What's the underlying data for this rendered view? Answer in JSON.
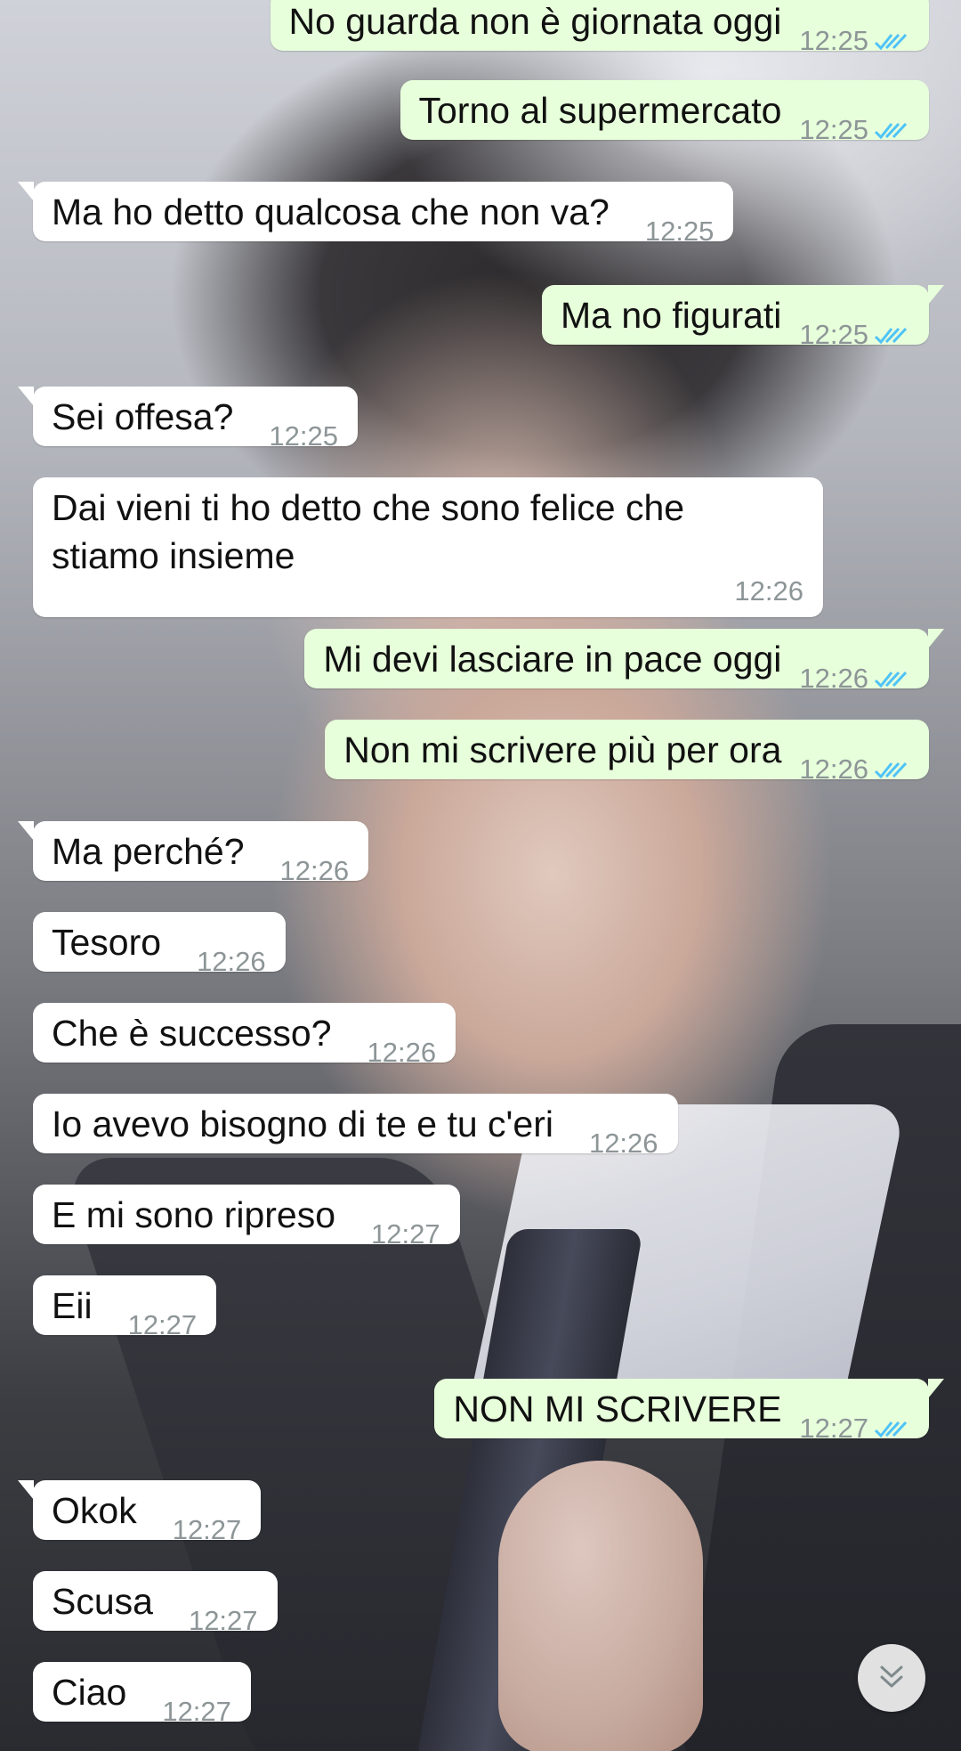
{
  "colors": {
    "incoming_bubble": "#ffffff",
    "outgoing_bubble": "#e7ffdb",
    "timestamp": "#8d9597",
    "read_ticks": "#4fc3f7"
  },
  "messages": [
    {
      "dir": "out",
      "text": "No guarda non è giornata oggi",
      "time": "12:25",
      "status": "read"
    },
    {
      "dir": "out",
      "text": "Torno al supermercato",
      "time": "12:25",
      "status": "read"
    },
    {
      "dir": "in",
      "text": "Ma ho detto qualcosa che non va?",
      "time": "12:25"
    },
    {
      "dir": "out",
      "text": "Ma no figurati",
      "time": "12:25",
      "status": "read"
    },
    {
      "dir": "in",
      "text": "Sei offesa?",
      "time": "12:25"
    },
    {
      "dir": "in",
      "text_line1": "Dai vieni ti ho detto che sono felice che",
      "text_line2": "stiamo insieme",
      "time": "12:26"
    },
    {
      "dir": "out",
      "text": "Mi devi lasciare in pace oggi",
      "time": "12:26",
      "status": "read"
    },
    {
      "dir": "out",
      "text": "Non mi scrivere più per ora",
      "time": "12:26",
      "status": "read"
    },
    {
      "dir": "in",
      "text": "Ma perché?",
      "time": "12:26"
    },
    {
      "dir": "in",
      "text": "Tesoro",
      "time": "12:26"
    },
    {
      "dir": "in",
      "text": "Che è successo?",
      "time": "12:26"
    },
    {
      "dir": "in",
      "text": "Io avevo bisogno di te e tu c'eri",
      "time": "12:26"
    },
    {
      "dir": "in",
      "text": "E mi sono ripreso",
      "time": "12:27"
    },
    {
      "dir": "in",
      "text": "Eii",
      "time": "12:27"
    },
    {
      "dir": "out",
      "text": "NON MI SCRIVERE",
      "time": "12:27",
      "status": "read"
    },
    {
      "dir": "in",
      "text": "Okok",
      "time": "12:27"
    },
    {
      "dir": "in",
      "text": "Scusa",
      "time": "12:27"
    },
    {
      "dir": "in",
      "text": "Ciao",
      "time": "12:27"
    }
  ],
  "scroll_button_icon": "double-chevron-down-icon"
}
